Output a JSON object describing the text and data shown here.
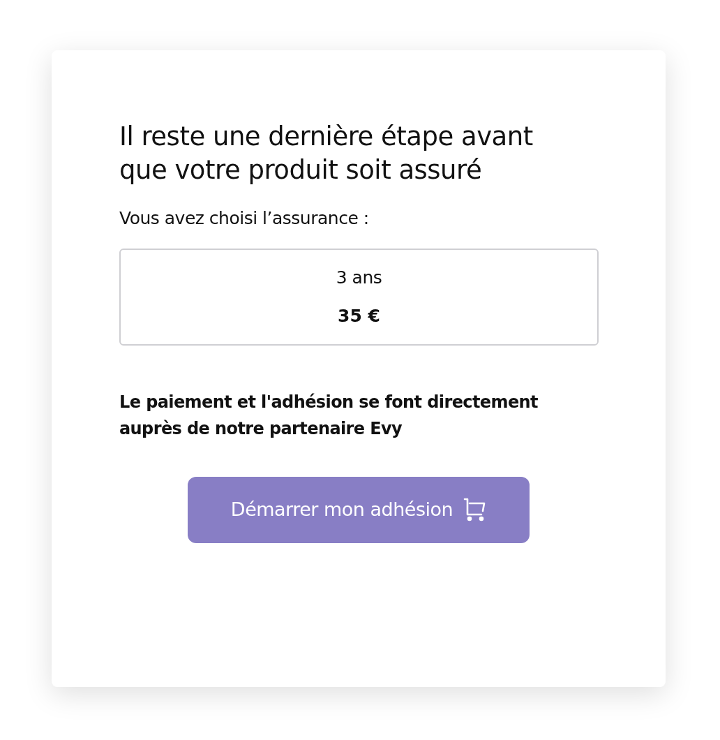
{
  "title": "Il reste une dernière étape avant que votre produit soit assuré",
  "intro": "Vous avez choisi l’assurance :",
  "offer": {
    "duration": "3 ans",
    "price": "35 €"
  },
  "notice": "Le paiement et l'adhésion se font directement auprès de notre partenaire Evy",
  "button": {
    "label": "Démarrer mon adhésion"
  }
}
